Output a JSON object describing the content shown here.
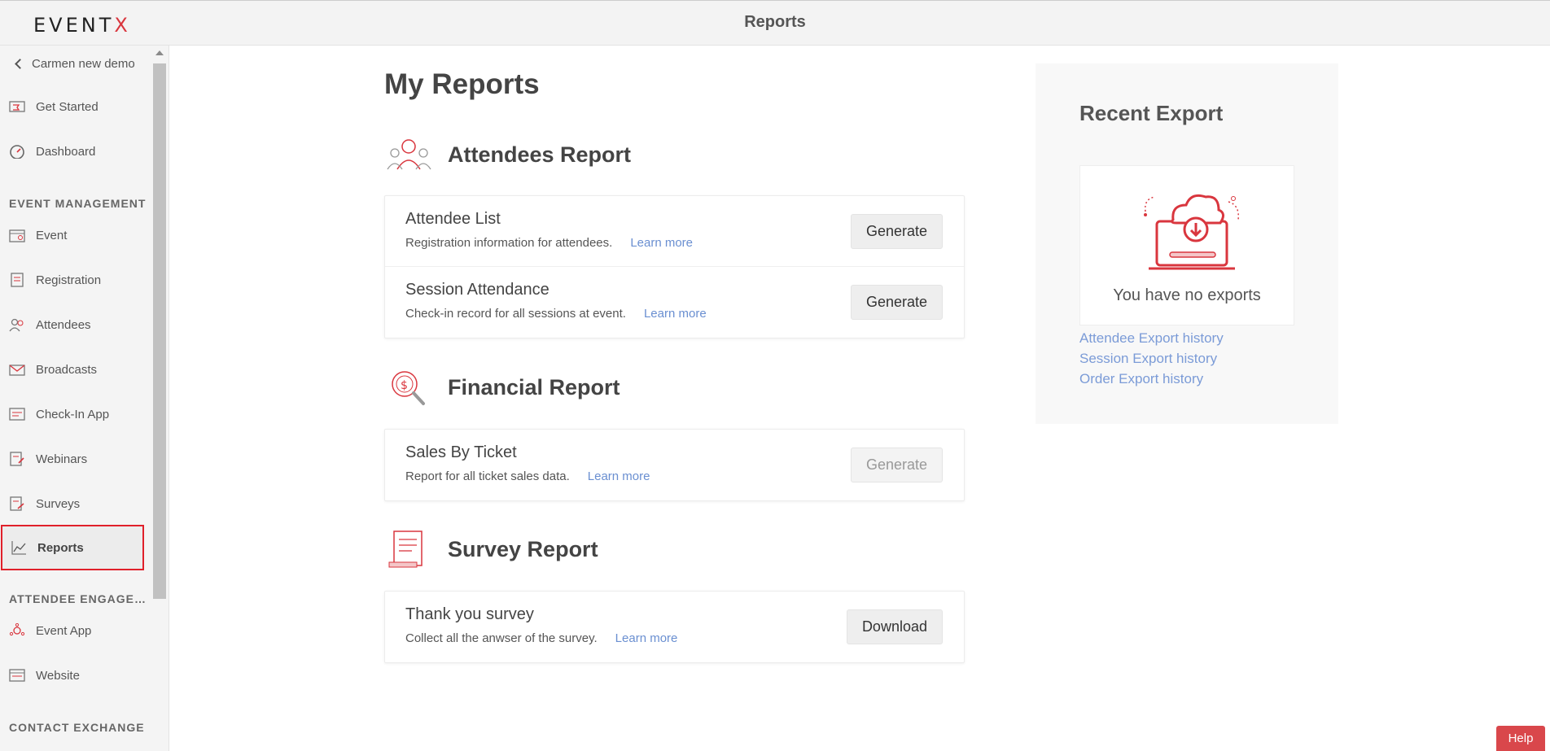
{
  "app": {
    "logo_text": "EVENT",
    "logo_accent": "X",
    "page_title": "Reports",
    "brand_color": "#d9363e"
  },
  "sidebar": {
    "back_label": "Carmen new demo",
    "items_top": [
      {
        "label": "Get Started",
        "icon": "flag-icon"
      },
      {
        "label": "Dashboard",
        "icon": "gauge-icon"
      }
    ],
    "section_event_management": "EVENT MANAGEMENT",
    "items_event": [
      {
        "label": "Event",
        "icon": "calendar-icon"
      },
      {
        "label": "Registration",
        "icon": "form-icon"
      },
      {
        "label": "Attendees",
        "icon": "people-icon"
      },
      {
        "label": "Broadcasts",
        "icon": "envelope-icon"
      },
      {
        "label": "Check-In App",
        "icon": "checkin-icon"
      },
      {
        "label": "Webinars",
        "icon": "webinar-icon"
      },
      {
        "label": "Surveys",
        "icon": "survey-icon"
      },
      {
        "label": "Reports",
        "icon": "chart-icon",
        "active": true
      }
    ],
    "section_attendee_engagement": "ATTENDEE ENGAGEMENT",
    "items_engagement": [
      {
        "label": "Event App",
        "icon": "app-icon"
      },
      {
        "label": "Website",
        "icon": "website-icon"
      }
    ],
    "section_contact_exchange": "CONTACT EXCHANGE"
  },
  "main": {
    "title": "My Reports",
    "attendees": {
      "heading": "Attendees Report",
      "rows": [
        {
          "title": "Attendee List",
          "desc": "Registration information for attendees.",
          "learn": "Learn more",
          "button": "Generate"
        },
        {
          "title": "Session Attendance",
          "desc": "Check-in record for all sessions at event.",
          "learn": "Learn more",
          "button": "Generate"
        }
      ]
    },
    "financial": {
      "heading": "Financial Report",
      "rows": [
        {
          "title": "Sales By Ticket",
          "desc": "Report for all ticket sales data.",
          "learn": "Learn more",
          "button": "Generate",
          "disabled": true
        }
      ]
    },
    "survey": {
      "heading": "Survey Report",
      "rows": [
        {
          "title": "Thank you survey",
          "desc": "Collect all the anwser of the survey.",
          "learn": "Learn more",
          "button": "Download"
        }
      ]
    }
  },
  "export": {
    "title": "Recent Export",
    "empty_text": "You have no exports",
    "links": [
      "Attendee Export history",
      "Session Export history",
      "Order Export history"
    ]
  },
  "help_label": "Help"
}
